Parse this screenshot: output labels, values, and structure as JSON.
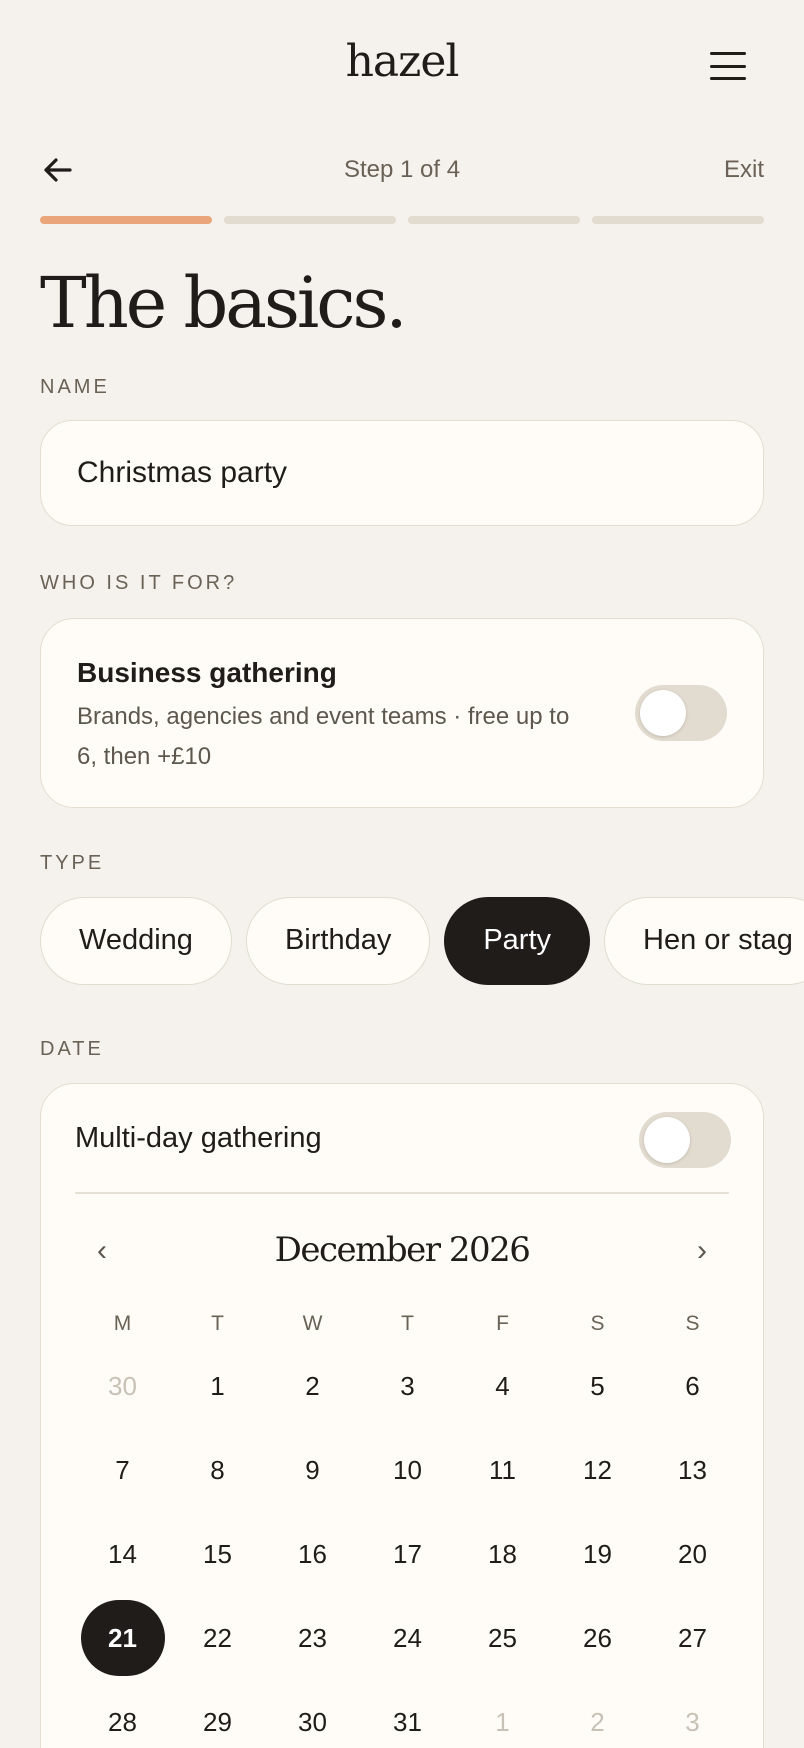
{
  "header": {
    "logo": "hazel",
    "menu_icon": "hamburger-menu-icon"
  },
  "step": {
    "text": "Step 1 of 4",
    "exit_label": "Exit",
    "back_icon": "arrow-left-icon",
    "current": 1,
    "total": 4
  },
  "page_title": "The basics.",
  "name_section": {
    "label": "NAME",
    "value": "Christmas party"
  },
  "who_section": {
    "label": "WHO IS IT FOR?",
    "business_title": "Business gathering",
    "business_desc": "Brands, agencies and event teams · free up to 6, then +£10",
    "toggle_on": false
  },
  "type_section": {
    "label": "TYPE",
    "options": [
      "Wedding",
      "Birthday",
      "Party",
      "Hen or stag"
    ],
    "selected": "Party"
  },
  "date_section": {
    "label": "DATE",
    "multi_day_label": "Multi-day gathering",
    "multi_day_on": false,
    "month": "December 2026",
    "prev_icon": "chevron-left-icon",
    "next_icon": "chevron-right-icon",
    "prev": "‹",
    "next": "›",
    "weekdays": [
      "M",
      "T",
      "W",
      "T",
      "F",
      "S",
      "S"
    ],
    "weeks": [
      [
        "30",
        "1",
        "2",
        "3",
        "4",
        "5",
        "6"
      ],
      [
        "7",
        "8",
        "9",
        "10",
        "11",
        "12",
        "13"
      ],
      [
        "14",
        "15",
        "16",
        "17",
        "18",
        "19",
        "20"
      ],
      [
        "21",
        "22",
        "23",
        "24",
        "25",
        "26",
        "27"
      ],
      [
        "28",
        "29",
        "30",
        "31",
        "1",
        "2",
        "3"
      ]
    ],
    "selected_day": "21"
  },
  "colors": {
    "accent": "#eaa57a",
    "dark": "#1f1c19",
    "background": "#f5f1ec",
    "card": "#fffcf7"
  }
}
